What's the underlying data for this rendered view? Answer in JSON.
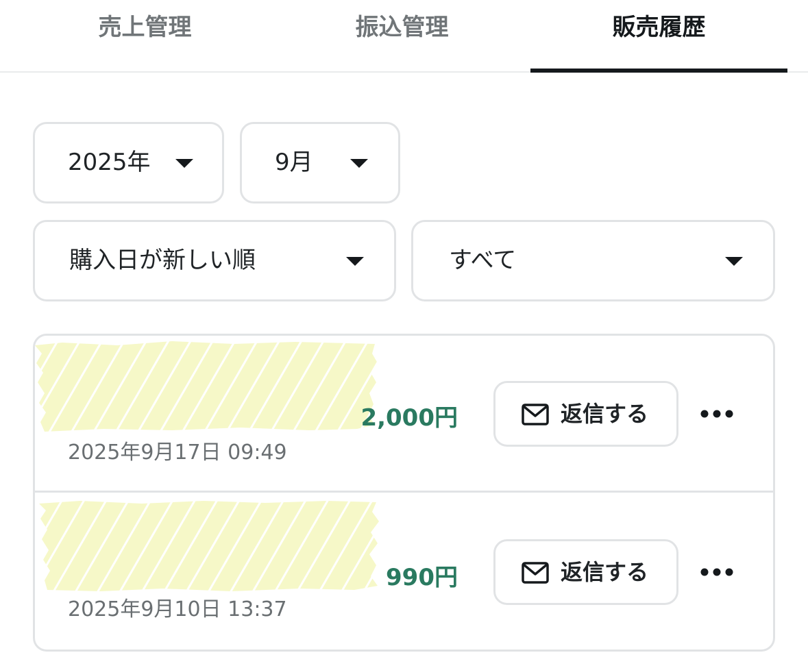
{
  "tabs": [
    {
      "label": "売上管理",
      "active": false
    },
    {
      "label": "振込管理",
      "active": false
    },
    {
      "label": "販売履歴",
      "active": true
    }
  ],
  "filters": {
    "year": "2025年",
    "month": "9月",
    "sort": "購入日が新しい順",
    "status": "すべて"
  },
  "sales": [
    {
      "price": "2,000円",
      "date": "2025年9月17日 09:49",
      "reply_label": "返信する"
    },
    {
      "price": "990円",
      "date": "2025年9月10日 13:37",
      "reply_label": "返信する"
    }
  ],
  "colors": {
    "accent_price": "#2a7a60",
    "active_tab": "#15191c",
    "redaction": "#f6f8c8"
  },
  "icons": {
    "dropdown": "caret-down-icon",
    "reply": "mail-icon",
    "more": "more-horizontal-icon"
  }
}
